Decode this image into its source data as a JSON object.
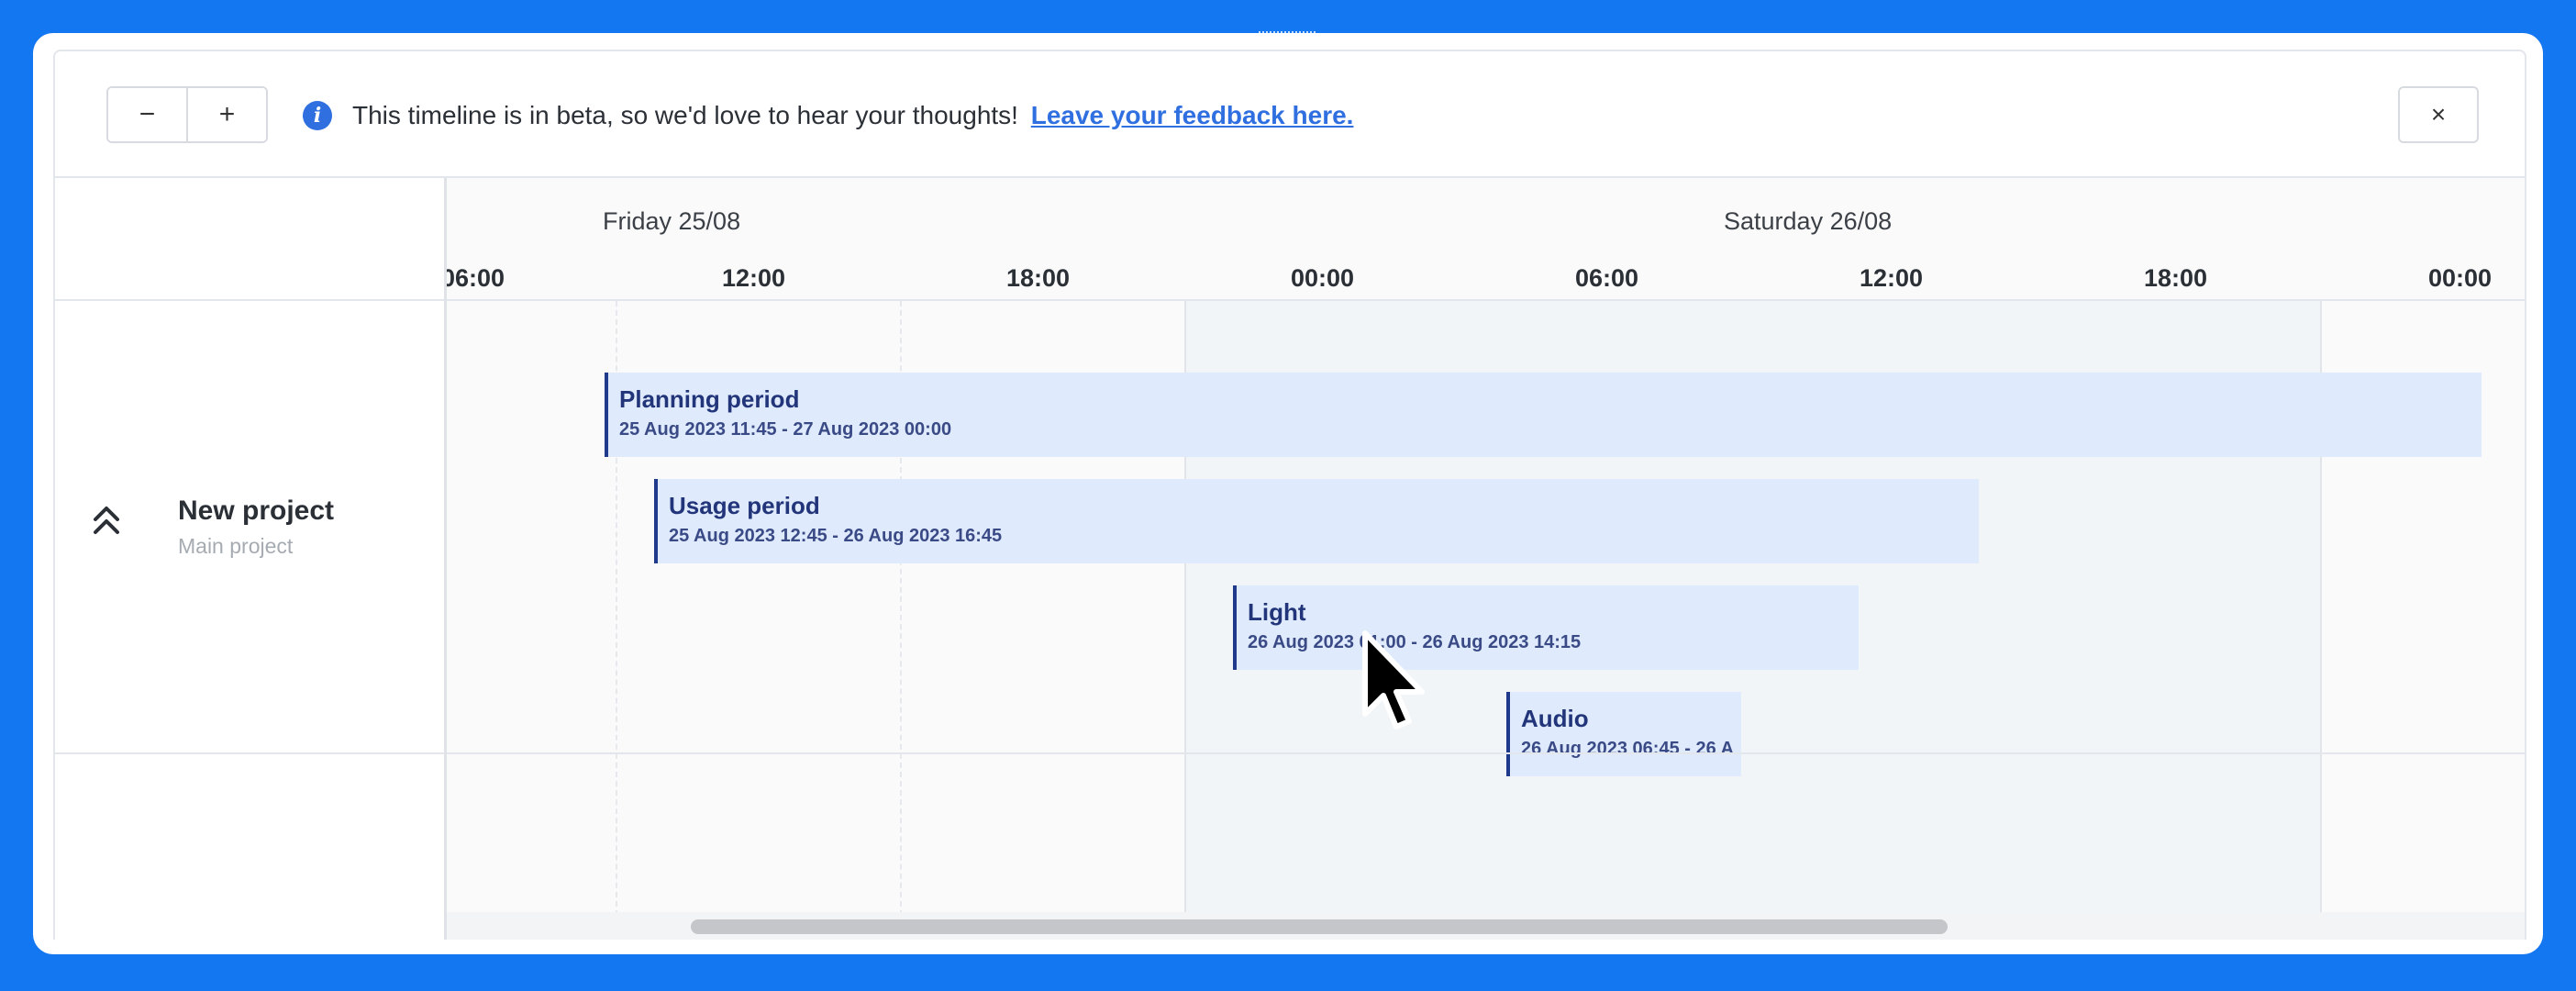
{
  "toolbar": {
    "zoom_out_label": "−",
    "zoom_in_label": "+",
    "info_icon": "info-icon",
    "beta_message": "This timeline is in beta, so we'd love to hear your thoughts!",
    "feedback_link": "Leave your feedback here.",
    "close_label": "×"
  },
  "project": {
    "name": "New project",
    "subtitle": "Main project",
    "collapse_icon": "double-chevron-up-icon"
  },
  "timeline": {
    "days": [
      "Friday 25/08",
      "Saturday 26/08"
    ],
    "hours": [
      "06:00",
      "12:00",
      "18:00",
      "00:00",
      "06:00",
      "12:00",
      "18:00",
      "00:00"
    ],
    "bars": [
      {
        "title": "Planning period",
        "range": "25 Aug 2023 11:45 - 27 Aug 2023 00:00"
      },
      {
        "title": "Usage period",
        "range": "25 Aug 2023 12:45 - 26 Aug 2023 16:45"
      },
      {
        "title": "Light",
        "range": "26 Aug 2023 01:00 - 26 Aug 2023 14:15"
      },
      {
        "title": "Audio",
        "range": "26 Aug 2023 06:45 - 26 A"
      }
    ]
  },
  "colors": {
    "background": "#1477f2",
    "bar_fill": "#dfebfc",
    "bar_accent": "#1f3a8a",
    "link": "#2f6fe0"
  }
}
